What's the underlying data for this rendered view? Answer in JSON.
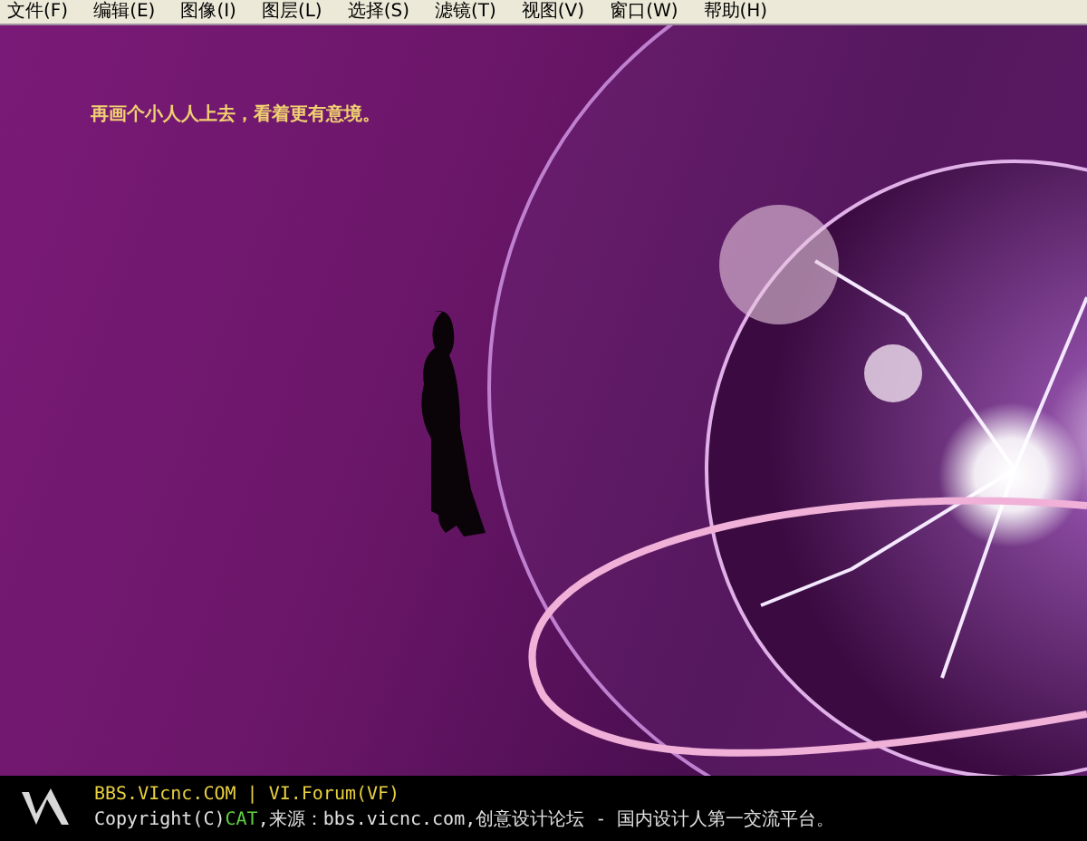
{
  "menu_bar": {
    "items": [
      {
        "label": "文件(F)"
      },
      {
        "label": "编辑(E)"
      },
      {
        "label": "图像(I)"
      },
      {
        "label": "图层(L)"
      },
      {
        "label": "选择(S)"
      },
      {
        "label": "滤镜(T)"
      },
      {
        "label": "视图(V)"
      },
      {
        "label": "窗口(W)"
      },
      {
        "label": "帮助(H)"
      }
    ]
  },
  "canvas": {
    "caption": "再画个小人人上去，看着更有意境。"
  },
  "footer": {
    "site_line": "BBS.VIcnc.COM | VI.Forum(VF)",
    "copyright": [
      {
        "kind": "plain",
        "text": "Copyright(C)"
      },
      {
        "kind": "highlight",
        "text": "CAT"
      },
      {
        "kind": "plain",
        "text": ",来源：bbs.vicnc.com,创意设计论坛 - 国内设计人第一交流平台。"
      }
    ]
  }
}
